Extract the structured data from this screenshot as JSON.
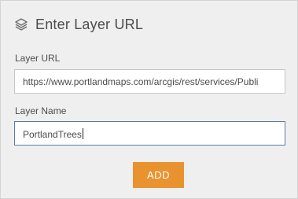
{
  "header": {
    "icon": "layers-icon",
    "title": "Enter Layer URL"
  },
  "form": {
    "url_label": "Layer URL",
    "url_value": "https://www.portlandmaps.com/arcgis/rest/services/Publi",
    "name_label": "Layer Name",
    "name_value": "PortlandTrees"
  },
  "actions": {
    "add_label": "ADD"
  },
  "colors": {
    "panel_bg": "#efefef",
    "accent": "#e8932f",
    "focus_border": "#5b7ca8"
  }
}
